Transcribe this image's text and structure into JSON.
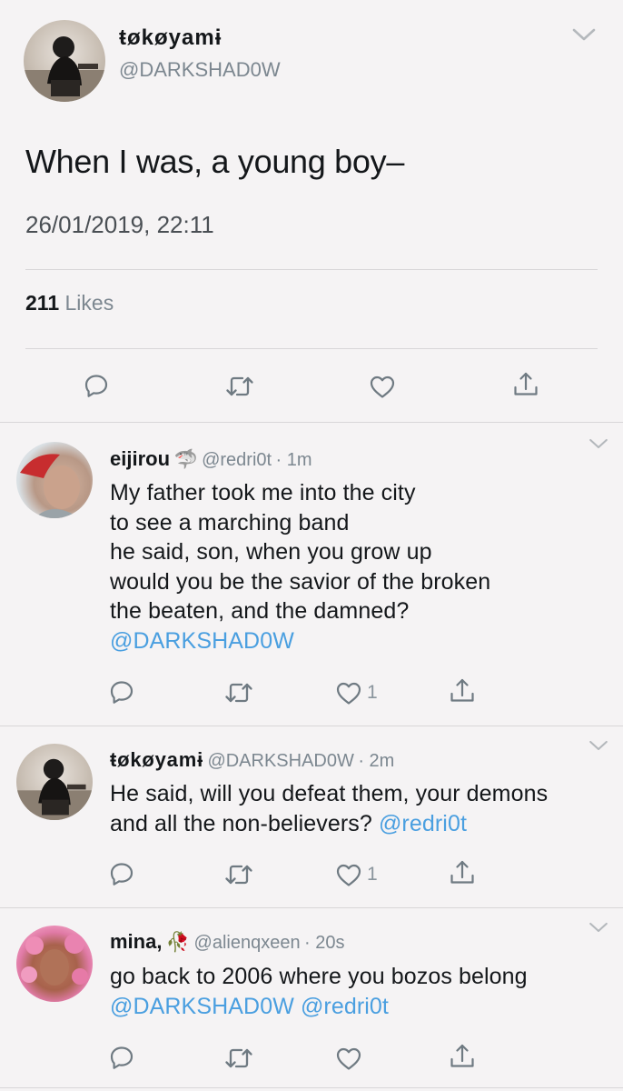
{
  "main_tweet": {
    "display_name": "ŧøkøyamɨ",
    "handle": "@DARKSHAD0W",
    "text": "When I was, a young boy–",
    "timestamp": "26/01/2019, 22:11",
    "likes_count": "211",
    "likes_label": "Likes"
  },
  "replies": [
    {
      "display_name": "eijirou",
      "name_emoji": "🦈",
      "handle": "@redri0t",
      "time": "· 1m",
      "lines": [
        "My father took me into the city",
        "to see a marching band",
        "he said, son, when you grow up",
        "would you be the savior of the broken",
        "the beaten, and the damned?"
      ],
      "mentions": "@DARKSHAD0W",
      "like_count": "1"
    },
    {
      "display_name": "ŧøkøyamɨ",
      "handle": "@DARKSHAD0W",
      "time": "· 2m",
      "lines": [
        "He said, will you defeat them, your demons",
        "and all the non-believers?"
      ],
      "mentions": "@redri0t",
      "like_count": "1"
    },
    {
      "display_name": "mina,",
      "name_emoji": "🥀",
      "handle": "@alienqxeen",
      "time": "· 20s",
      "lines": [
        "go back to 2006 where you bozos belong"
      ],
      "mentions": "@DARKSHAD0W @redri0t",
      "like_count": ""
    }
  ],
  "icons": {
    "reply": "reply-icon",
    "retweet": "retweet-icon",
    "like": "heart-icon",
    "share": "share-icon",
    "menu": "chevron-down-icon"
  },
  "colors": {
    "background": "#f5f3f4",
    "link": "#4a9fe0",
    "muted": "#7c8790",
    "icon": "#6f7a82"
  }
}
